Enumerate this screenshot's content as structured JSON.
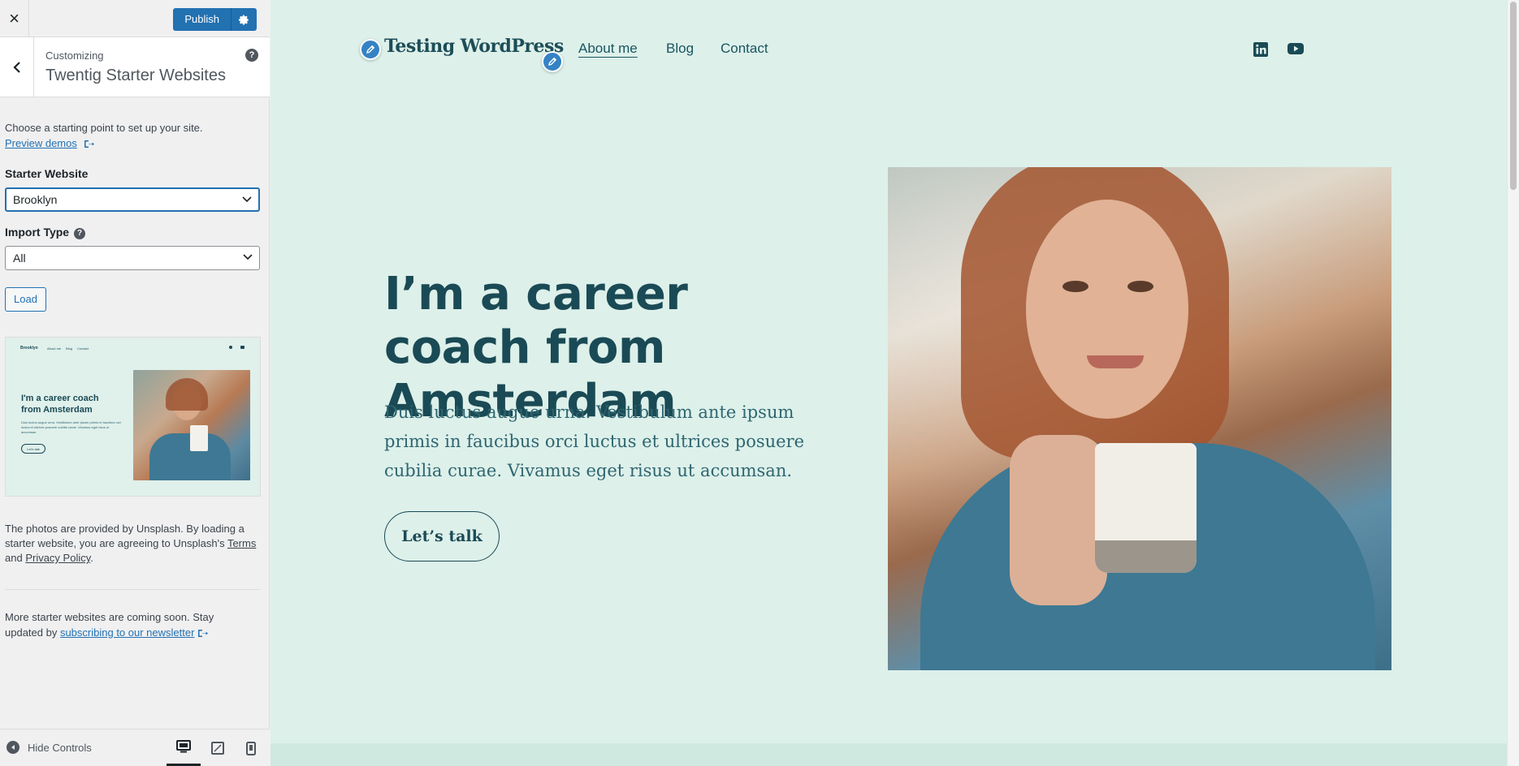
{
  "topbar": {
    "close": "×",
    "publish_label": "Publish"
  },
  "section": {
    "customizing": "Customizing",
    "title": "Twentig Starter Websites",
    "help": "?"
  },
  "panel": {
    "intro": "Choose a starting point to set up your site.",
    "preview_link": "Preview demos",
    "starter_label": "Starter Website",
    "starter_value": "Brooklyn",
    "import_label": "Import Type",
    "import_value": "All",
    "load_label": "Load",
    "note_1": "The photos are provided by Unsplash. By loading a starter website, you are agreeing to Unsplash's ",
    "note_terms": "Terms",
    "note_and": "and ",
    "note_privacy": "Privacy Policy",
    "note_end": ".",
    "more_1": "More starter websites are coming soon. Stay updated by ",
    "more_link": "subscribing to our newsletter"
  },
  "thumb": {
    "logo": "Brooklyn",
    "nav": [
      "About me",
      "Blog",
      "Contact"
    ],
    "title": "I'm a career coach from Amsterdam",
    "text": "Duis luctus augue urna. Vestibulum ante ipsum primis in faucibus orci luctus et ultrices posuere cubilia curae. Vivamus eget risus ut accumsan.",
    "button": "Let's talk"
  },
  "bottombar": {
    "hide_controls": "Hide Controls"
  },
  "preview": {
    "site_title": "Testing WordPress",
    "nav": [
      "About me",
      "Blog",
      "Contact"
    ],
    "hero_title": "I’m a career coach from Amsterdam",
    "hero_text": "Duis luctus augue urna. Vestibulum ante ipsum primis in faucibus orci luctus et ultrices posuere cubilia curae. Vivamus eget risus ut accumsan.",
    "cta": "Let’s talk"
  },
  "colors": {
    "accent": "#2271b1",
    "preview_bg": "#ddf0ea",
    "heading": "#1a4a55"
  }
}
